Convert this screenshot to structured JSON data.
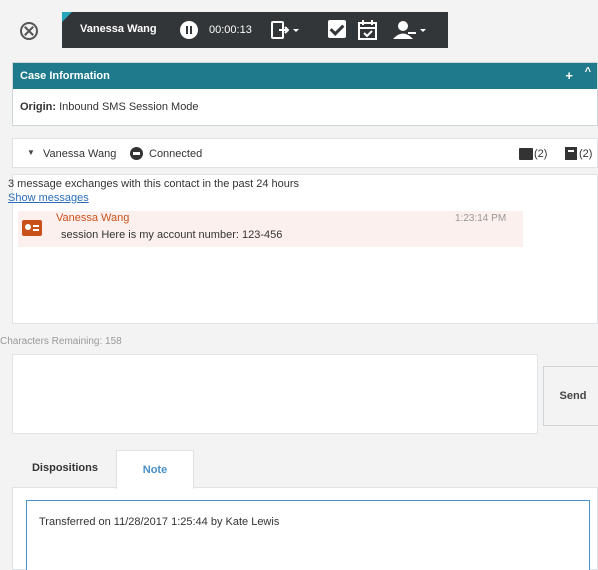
{
  "toolbar": {
    "agent_name": "Vanessa Wang",
    "timer": "00:00:13",
    "icons": [
      "close-circle-icon",
      "hold-icon",
      "transfer-icon",
      "mark-done-icon",
      "calendar-icon",
      "consult-icon"
    ]
  },
  "case_info": {
    "header": "Case Information",
    "plus": "+",
    "caret": "^",
    "origin_label": "Origin:",
    "origin_value": "Inbound SMS Session Mode"
  },
  "interaction": {
    "caret": "▼",
    "name": "Vanessa Wang",
    "status": "Connected",
    "case_data_count": "(2)",
    "history_count": "(2)"
  },
  "transcript": {
    "history_text": "3 message exchanges with this contact in the past 24 hours",
    "show_messages": "Show messages",
    "message": {
      "sender": "Vanessa Wang",
      "time": "1:23:14 PM",
      "text": "session Here is my account number: 123-456"
    }
  },
  "composer": {
    "chars_remaining": "Characters Remaining: 158",
    "send_label": "Send"
  },
  "tabs": {
    "dispositions": "Dispositions",
    "note": "Note"
  },
  "note_text": "Transferred on 11/28/2017 1:25:44 by Kate Lewis",
  "colors": {
    "toolbar_bg": "#333638",
    "accent_teal": "#27a6ba",
    "case_header_bg": "#1f7a8c",
    "sender_orange": "#c9521b",
    "message_bg": "#fbf0ee",
    "link_blue": "#2a6ebb",
    "tab_active_blue": "#4a90c8"
  }
}
